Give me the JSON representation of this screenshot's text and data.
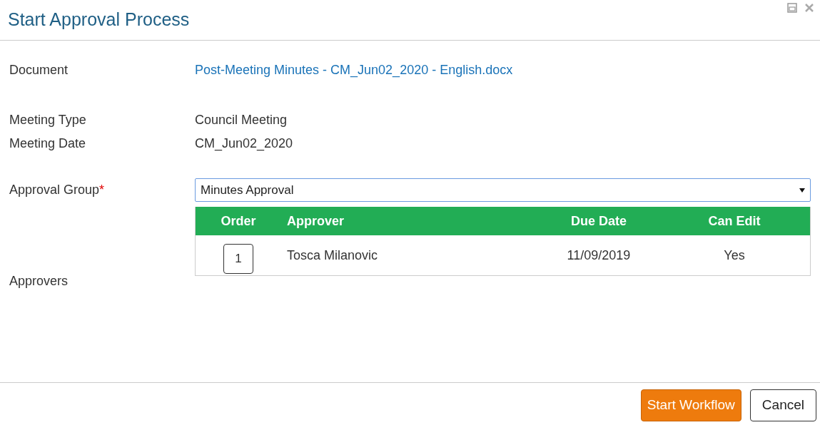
{
  "window": {
    "title": "Start Approval Process"
  },
  "fields": [
    {
      "kind": "link",
      "label": "Document",
      "value": "Post-Meeting Minutes - CM_Jun02_2020 - English.docx"
    },
    {
      "kind": "text",
      "label": "Meeting Type",
      "value": "Council Meeting"
    },
    {
      "kind": "text",
      "label": "Meeting Date",
      "value": "CM_Jun02_2020"
    }
  ],
  "approval_group": {
    "label": "Approval Group",
    "required_mark": "*",
    "value": "Minutes Approval"
  },
  "approvers": {
    "label": "Approvers",
    "columns": [
      "Order",
      "Approver",
      "Due Date",
      "Can Edit"
    ],
    "rows": [
      {
        "order": "1",
        "approver": "Tosca Milanovic",
        "due_date": "11/09/2019",
        "can_edit": "Yes"
      }
    ]
  },
  "buttons": [
    {
      "label": "Start Workflow",
      "primary": true
    },
    {
      "label": "Cancel",
      "primary": false
    }
  ]
}
